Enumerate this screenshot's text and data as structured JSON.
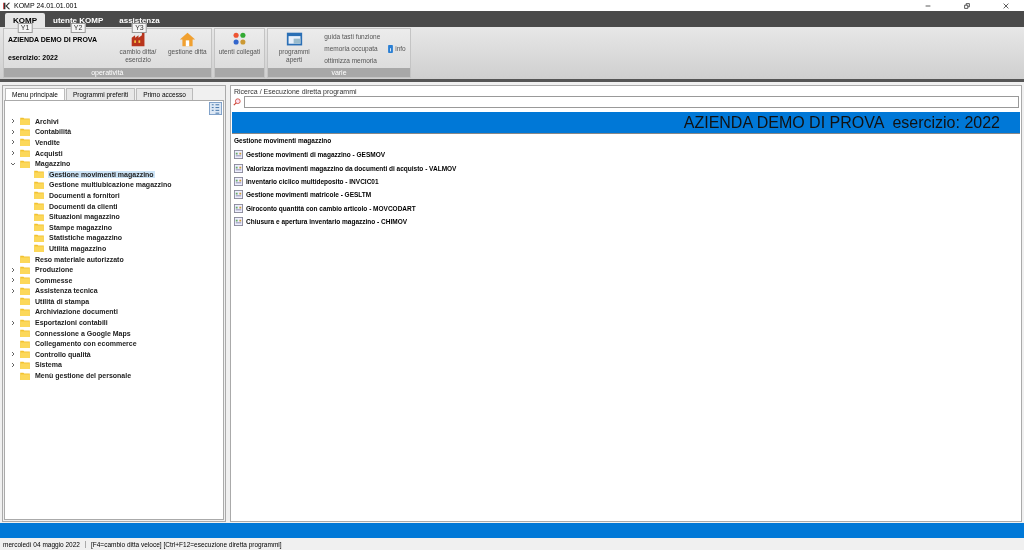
{
  "window": {
    "title": "KOMP 24.01.01.001"
  },
  "menu_tabs": [
    {
      "label": "KOMP",
      "key_tip": "Y1",
      "selected": true
    },
    {
      "label": "utente KOMP",
      "key_tip": "Y2",
      "selected": false
    },
    {
      "label": "assistenza",
      "key_tip": "Y3",
      "selected": false
    }
  ],
  "ribbon": {
    "company": "AZIENDA DEMO DI PROVA",
    "year": "esercizio: 2022",
    "groups": [
      {
        "label": "operatività",
        "buttons": [
          {
            "label": "cambio ditta/ esercizio"
          },
          {
            "label": "gestione ditta"
          }
        ]
      },
      {
        "buttons": [
          {
            "label": "utenti collegati"
          }
        ]
      },
      {
        "label": "varie",
        "buttons": [
          {
            "label": "programmi aperti"
          }
        ],
        "links": [
          "guida tasti funzione",
          "memoria occupata",
          "ottimizza memoria"
        ],
        "info": "info"
      }
    ]
  },
  "left_tabs": [
    {
      "label": "Menu principale",
      "selected": true
    },
    {
      "label": "Programmi preferiti",
      "selected": false
    },
    {
      "label": "Primo accesso",
      "selected": false
    }
  ],
  "tree": [
    {
      "label": "Archivi",
      "expanded": false,
      "selected": false
    },
    {
      "label": "Contabilità",
      "expanded": false,
      "selected": false
    },
    {
      "label": "Vendite",
      "expanded": false,
      "selected": false
    },
    {
      "label": "Acquisti",
      "expanded": false,
      "selected": false
    },
    {
      "label": "Magazzino",
      "expanded": true,
      "selected": false,
      "children": [
        {
          "label": "Gestione movimenti magazzino",
          "selected": true
        },
        {
          "label": "Gestione multiubicazione magazzino",
          "selected": false
        },
        {
          "label": "Documenti a fornitori",
          "selected": false
        },
        {
          "label": "Documenti da clienti",
          "selected": false
        },
        {
          "label": "Situazioni magazzino",
          "selected": false
        },
        {
          "label": "Stampe magazzino",
          "selected": false
        },
        {
          "label": "Statistiche magazzino",
          "selected": false
        },
        {
          "label": "Utilità magazzino",
          "selected": false
        }
      ]
    },
    {
      "label": "Reso materiale autorizzato",
      "selected": false
    },
    {
      "label": "Produzione",
      "expanded": false,
      "selected": false
    },
    {
      "label": "Commesse",
      "expanded": false,
      "selected": false
    },
    {
      "label": "Assistenza tecnica",
      "expanded": false,
      "selected": false
    },
    {
      "label": "Utilità di stampa",
      "selected": false
    },
    {
      "label": "Archiviazione documenti",
      "selected": false
    },
    {
      "label": "Esportazioni contabili",
      "expanded": false,
      "selected": false
    },
    {
      "label": "Connessione a Google Maps",
      "selected": false
    },
    {
      "label": "Collegamento con ecommerce",
      "selected": false
    },
    {
      "label": "Controllo qualità",
      "expanded": false,
      "selected": false
    },
    {
      "label": "Sistema",
      "expanded": false,
      "selected": false
    },
    {
      "label": "Menù gestione del personale",
      "selected": false
    }
  ],
  "search": {
    "label": "Ricerca / Esecuzione diretta programmi"
  },
  "banner": "AZIENDA DEMO DI PROVA  esercizio: 2022",
  "programs": {
    "heading": "Gestione movimenti magazzino",
    "items": [
      "Gestione movimenti di magazzino - GESMOV",
      "Valorizza movimenti magazzino da documenti di acquisto - VALMOV",
      "Inventario ciclico multideposito - INVCIC01",
      "Gestione movimenti matricole - GESLTM",
      "Giroconto quantità con cambio articolo - MOVCODART",
      "Chiusura e apertura inventario magazzino - CHIMOV"
    ]
  },
  "status_bar": {
    "date": "mercoledì 04 maggio 2022",
    "hints": "[F4=cambio ditta veloce] [Ctrl+F12=esecuzione diretta programmi]"
  }
}
